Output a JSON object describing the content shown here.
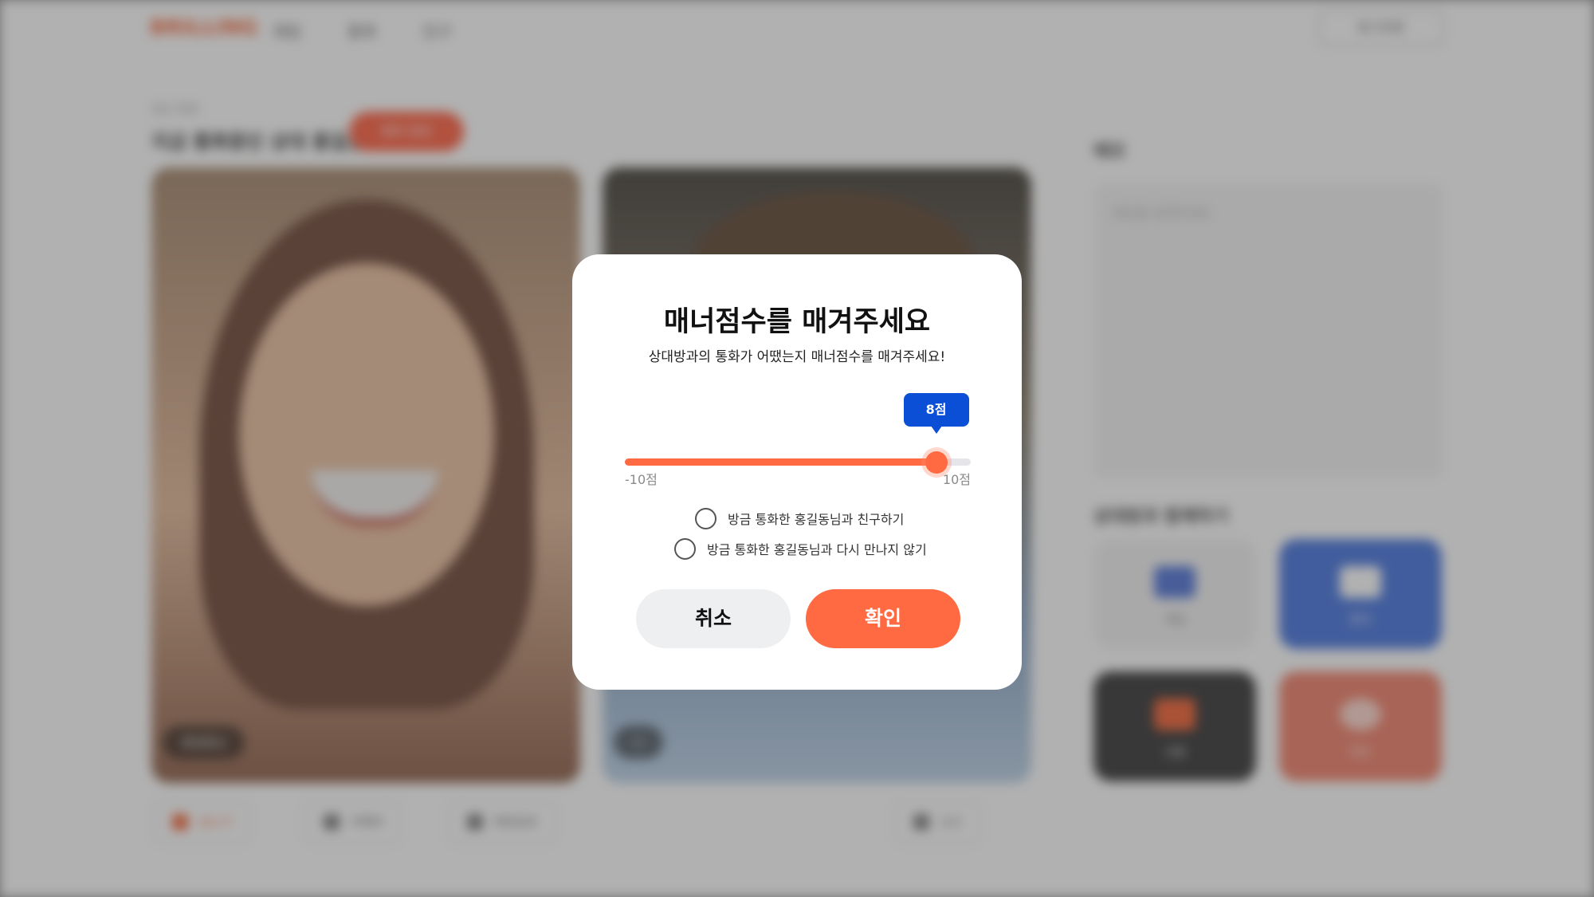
{
  "background": {
    "logo": "BRILLING",
    "nav": [
      "채팅",
      "통화",
      "친구"
    ],
    "nav_button": "로그아웃",
    "breadcrumb": "영상 통화",
    "call_title": "지금 통화중인 상대 홍길동",
    "call_badge": "통화 종료",
    "left_name": "홍길동님",
    "right_name": "나",
    "controls": [
      "음소거",
      "카메라",
      "화면공유",
      "신고"
    ],
    "memo_title": "메모",
    "memo_placeholder": "메모를 입력하세요",
    "features_title": "상대방과 함께하기",
    "tiles": [
      "게임",
      "편지",
      "선물",
      "하트"
    ]
  },
  "modal": {
    "title": "매너점수를 매겨주세요",
    "subtitle": "상대방과의 통화가 어땠는지 매너점수를 매겨주세요!",
    "slider": {
      "min": -10,
      "max": 10,
      "value": 8,
      "value_label": "8점",
      "min_label": "-10점",
      "max_label": "10점"
    },
    "options": [
      {
        "label": "방금 통화한 홍길동님과 친구하기",
        "checked": false
      },
      {
        "label": "방금 통화한 홍길동님과 다시 만나지 않기",
        "checked": false
      }
    ],
    "cancel_label": "취소",
    "confirm_label": "확인"
  },
  "colors": {
    "accent": "#ff6a42",
    "tooltip": "#0b4fd6",
    "cancel_bg": "#eeeff1"
  }
}
